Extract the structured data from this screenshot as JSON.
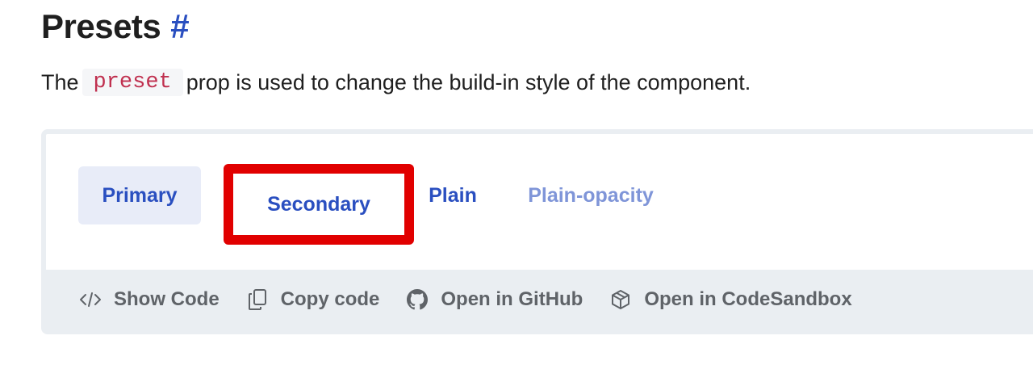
{
  "heading": {
    "title": "Presets",
    "anchor": "#"
  },
  "description": {
    "before": "The",
    "code": "preset",
    "after": "prop is used to change the build-in style of the component."
  },
  "demo": {
    "buttons": [
      {
        "label": "Primary"
      },
      {
        "label": "Secondary"
      },
      {
        "label": "Plain"
      },
      {
        "label": "Plain-opacity"
      }
    ],
    "actions": [
      {
        "label": "Show Code",
        "icon": "code-icon"
      },
      {
        "label": "Copy code",
        "icon": "copy-icon"
      },
      {
        "label": "Open in GitHub",
        "icon": "github-icon"
      },
      {
        "label": "Open in CodeSandbox",
        "icon": "codesandbox-icon"
      }
    ]
  },
  "colors": {
    "accent": "#2a4fc0",
    "highlight_border": "#e10000",
    "code_text": "#c0304f"
  }
}
